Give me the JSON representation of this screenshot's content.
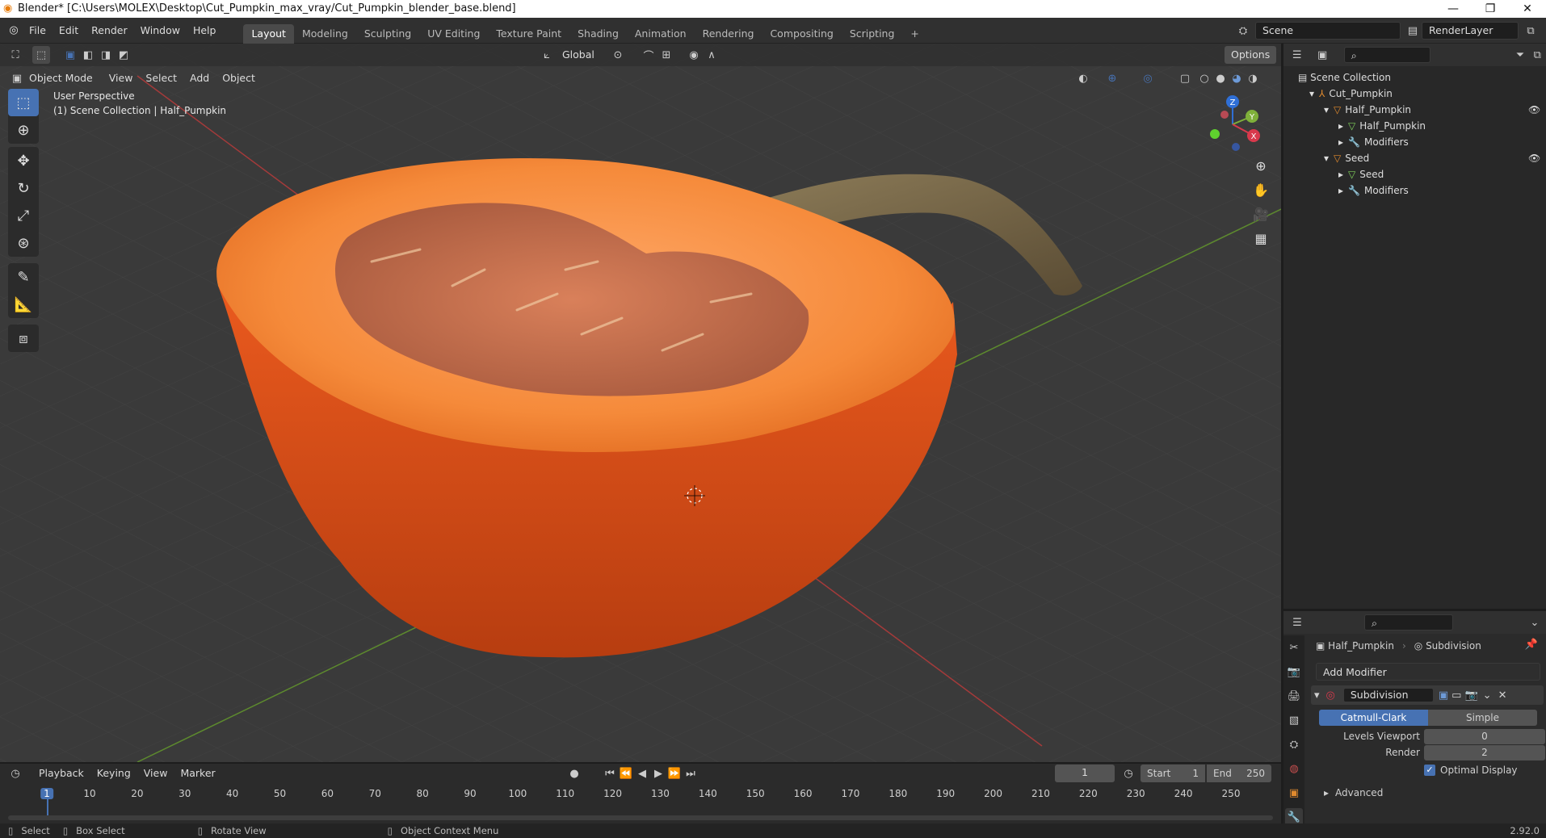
{
  "titlebar": {
    "title": "Blender* [C:\\Users\\MOLEX\\Desktop\\Cut_Pumpkin_max_vray/Cut_Pumpkin_blender_base.blend]",
    "minimize": "—",
    "maximize": "❐",
    "close": "✕"
  },
  "menu": [
    "File",
    "Edit",
    "Render",
    "Window",
    "Help"
  ],
  "workspaces": [
    "Layout",
    "Modeling",
    "Sculpting",
    "UV Editing",
    "Texture Paint",
    "Shading",
    "Animation",
    "Rendering",
    "Compositing",
    "Scripting",
    "+"
  ],
  "active_workspace": "Layout",
  "scene": {
    "name": "Scene",
    "view_layer": "RenderLayer"
  },
  "viewport": {
    "transform_orientation": "Global",
    "options_label": "Options",
    "mode": "Object Mode",
    "header_menus": [
      "View",
      "Select",
      "Add",
      "Object"
    ],
    "overlay_title": "User Perspective",
    "overlay_subtitle": "(1) Scene Collection | Half_Pumpkin",
    "gizmo": {
      "z": "Z",
      "y": "Y",
      "x": "X"
    }
  },
  "outliner": {
    "root": "Scene Collection",
    "rows": [
      {
        "label": "Cut_Pumpkin",
        "indent": 1,
        "expand": "▾",
        "icon": "empty-icon"
      },
      {
        "label": "Half_Pumpkin",
        "indent": 2,
        "expand": "▾",
        "icon": "mesh-object-icon"
      },
      {
        "label": "Half_Pumpkin",
        "indent": 3,
        "expand": "▸",
        "icon": "mesh-data-icon"
      },
      {
        "label": "Modifiers",
        "indent": 3,
        "expand": "▸",
        "icon": "wrench-icon"
      },
      {
        "label": "Seed",
        "indent": 2,
        "expand": "▾",
        "icon": "mesh-object-icon"
      },
      {
        "label": "Seed",
        "indent": 3,
        "expand": "▸",
        "icon": "mesh-data-icon"
      },
      {
        "label": "Modifiers",
        "indent": 3,
        "expand": "▸",
        "icon": "wrench-icon"
      }
    ]
  },
  "properties": {
    "object_name": "Half_Pumpkin",
    "modifier_context": "Subdivision",
    "add_modifier": "Add Modifier",
    "modifier_name": "Subdivision",
    "tabs": [
      "Catmull-Clark",
      "Simple"
    ],
    "active_tab": "Catmull-Clark",
    "levels_viewport_label": "Levels Viewport",
    "levels_viewport_value": "0",
    "render_label": "Render",
    "render_value": "2",
    "optimal_display_label": "Optimal Display",
    "optimal_display_checked": true,
    "advanced_label": "Advanced"
  },
  "timeline": {
    "menus": [
      "Playback",
      "Keying",
      "View",
      "Marker"
    ],
    "current_frame": "1",
    "start_label": "Start",
    "start_value": "1",
    "end_label": "End",
    "end_value": "250",
    "ticks": [
      "1",
      "10",
      "20",
      "30",
      "40",
      "50",
      "60",
      "70",
      "80",
      "90",
      "100",
      "110",
      "120",
      "130",
      "140",
      "150",
      "160",
      "170",
      "180",
      "190",
      "200",
      "210",
      "220",
      "230",
      "240",
      "250"
    ]
  },
  "status": {
    "select": "Select",
    "box_select": "Box Select",
    "rotate_view": "Rotate View",
    "context_menu": "Object Context Menu",
    "version": "2.92.0"
  },
  "colors": {
    "accent": "#4772b3",
    "pumpkin_flesh": "#f58a3a",
    "pumpkin_skin": "#e0531a",
    "seed_cavity": "#c8744a",
    "stem": "#7a6a48",
    "axis_red": "#a53a3a",
    "axis_green": "#5d8a2e"
  }
}
